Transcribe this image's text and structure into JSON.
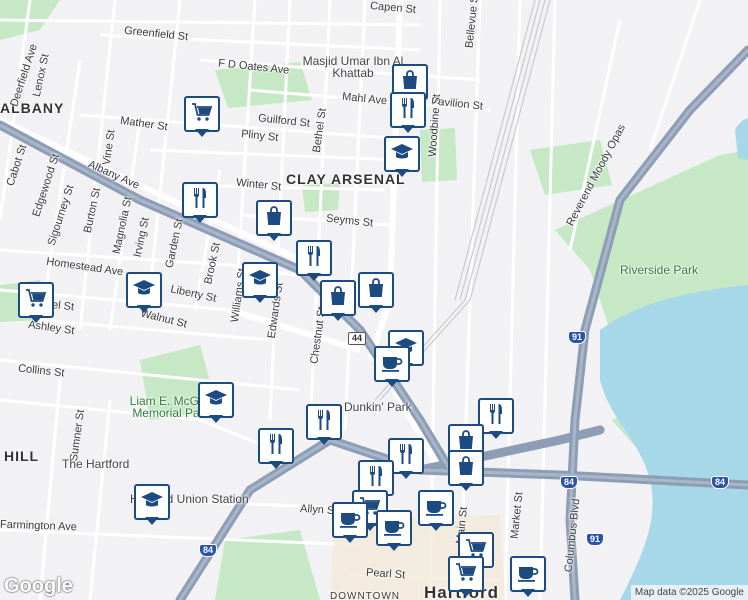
{
  "map": {
    "attribution": "Map data ©2025 Google",
    "logo": "Google",
    "colors": {
      "road": "#ffffff",
      "highway": "#8c9db5",
      "water": "#a6d8ea",
      "park": "#c6e8c4",
      "marker_border": "#1c4b82"
    },
    "labels": {
      "neighborhoods": [
        "ALBANY",
        "CLAY ARSENAL",
        "HILL",
        "DOWNTOWN",
        "Hartford"
      ],
      "streets": [
        "Capen St",
        "Greenfield St",
        "F D Oates Ave",
        "Mahl Ave",
        "Pavilion St",
        "Mather St",
        "Guilford St",
        "Pliny St",
        "Winter St",
        "Seyms St",
        "Albany Ave",
        "Homestead Ave",
        "Liberty St",
        "Walnut St",
        "Ashley St",
        "Collins St",
        "Allyn St",
        "Pearl St",
        "Farmington Ave",
        "Reverend Moody Opas",
        "Columbus Blvd",
        "Market St",
        "Main St",
        "Woodbine St",
        "Bellevue St",
        "Bethel St",
        "Chestnut St",
        "Edwards St",
        "Williams St",
        "Brook St",
        "Garden St",
        "Irving St",
        "Magnolia St",
        "Burton St",
        "Sigourney St",
        "Edgewood St",
        "Cabot St",
        "Vine St",
        "Lenox St",
        "Deerfield Ave",
        "Sumner St",
        "Laurel St",
        "Dunkin' Park",
        "Riverside Park"
      ],
      "pois": [
        "Masjid Umar Ibn Al Khattab",
        "Liam E. McGee Memorial Park",
        "The Hartford",
        "Hartford Union Station"
      ],
      "shields": [
        "44",
        "91",
        "84"
      ]
    },
    "markers": [
      {
        "icon": "bag-icon"
      },
      {
        "icon": "restaurant-icon"
      },
      {
        "icon": "cart-icon"
      },
      {
        "icon": "school-icon"
      },
      {
        "icon": "restaurant-icon"
      },
      {
        "icon": "bag-icon"
      },
      {
        "icon": "restaurant-icon"
      },
      {
        "icon": "school-icon"
      },
      {
        "icon": "bag-icon"
      },
      {
        "icon": "bag-icon"
      },
      {
        "icon": "cart-icon"
      },
      {
        "icon": "school-icon"
      },
      {
        "icon": "school-icon"
      },
      {
        "icon": "coffee-icon"
      },
      {
        "icon": "school-icon"
      },
      {
        "icon": "restaurant-icon"
      },
      {
        "icon": "restaurant-icon"
      },
      {
        "icon": "restaurant-icon"
      },
      {
        "icon": "bag-icon"
      },
      {
        "icon": "restaurant-icon"
      },
      {
        "icon": "restaurant-icon"
      },
      {
        "icon": "bag-icon"
      },
      {
        "icon": "school-icon"
      },
      {
        "icon": "cart-icon"
      },
      {
        "icon": "coffee-icon"
      },
      {
        "icon": "coffee-icon"
      },
      {
        "icon": "coffee-icon"
      },
      {
        "icon": "cart-icon"
      },
      {
        "icon": "cart-icon"
      },
      {
        "icon": "coffee-icon"
      }
    ]
  }
}
